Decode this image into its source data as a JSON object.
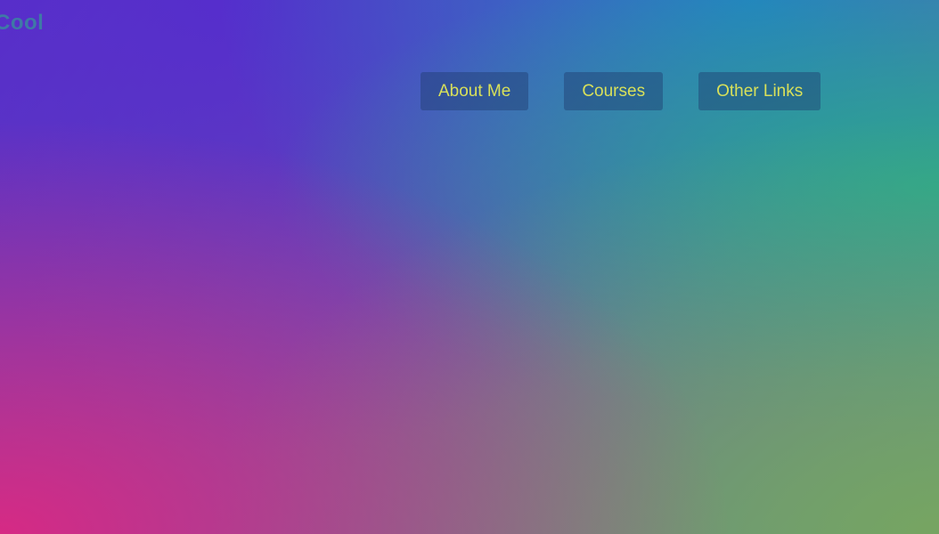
{
  "header": {
    "logo_text": "Cool"
  },
  "nav": {
    "items": [
      {
        "label": "About Me"
      },
      {
        "label": "Courses"
      },
      {
        "label": "Other Links"
      }
    ]
  },
  "colors": {
    "button_text": "#d8e05a",
    "logo_text": "#3f79a6"
  }
}
